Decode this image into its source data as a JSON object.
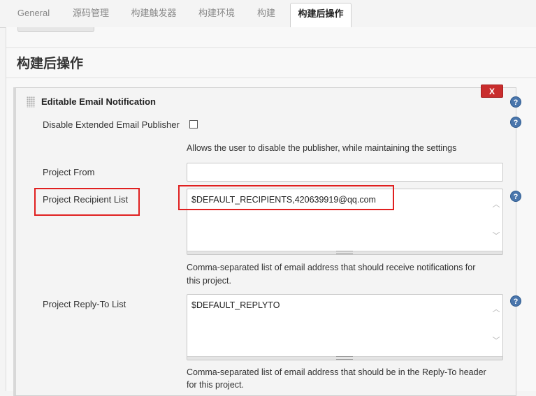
{
  "tabs": [
    {
      "label": "General"
    },
    {
      "label": "源码管理"
    },
    {
      "label": "构建触发器"
    },
    {
      "label": "构建环境"
    },
    {
      "label": "构建"
    },
    {
      "label": "构建后操作"
    }
  ],
  "section": {
    "title": "构建后操作"
  },
  "plugin": {
    "title": "Editable Email Notification",
    "delete_label": "X",
    "help_label": "?"
  },
  "fields": {
    "disable_publisher": {
      "label": "Disable Extended Email Publisher",
      "checked": false,
      "description": "Allows the user to disable the publisher, while maintaining the settings"
    },
    "project_from": {
      "label": "Project From",
      "value": ""
    },
    "recipient_list": {
      "label": "Project Recipient List",
      "value": "$DEFAULT_RECIPIENTS,420639919@qq.com",
      "description_line1": "Comma-separated list of email address that should receive notifications for",
      "description_line2": "this project."
    },
    "reply_to": {
      "label": "Project Reply-To List",
      "value": "$DEFAULT_REPLYTO",
      "description_line1": "Comma-separated list of email address that should be in the Reply-To header",
      "description_line2": "for this project."
    }
  },
  "colors": {
    "highlight": "#e02020",
    "delete_button": "#c92d2d",
    "help_icon": "#4a76ac"
  }
}
